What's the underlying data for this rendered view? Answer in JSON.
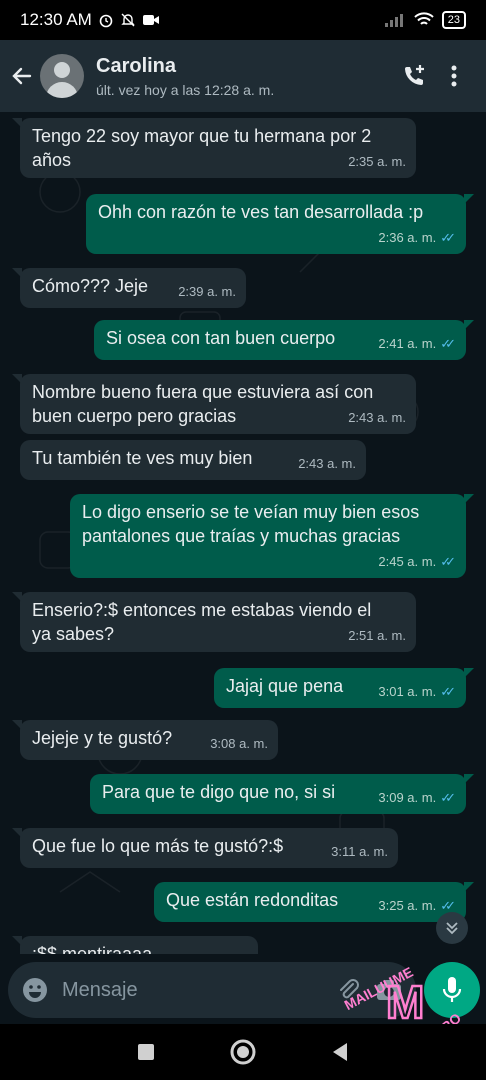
{
  "status_bar": {
    "time": "12:30 AM",
    "battery": "23"
  },
  "header": {
    "contact_name": "Carolina",
    "last_seen": "últ. vez hoy a las 12:28 a. m."
  },
  "messages": [
    {
      "dir": "in",
      "text": "Tengo 22 soy mayor que tu hermana por 2\naños",
      "time": "2:35 a. m."
    },
    {
      "dir": "out",
      "text": "Ohh con razón te ves tan desarrollada :p",
      "time": "2:36 a. m."
    },
    {
      "dir": "in",
      "text": "Cómo??? Jeje",
      "time": "2:39 a. m."
    },
    {
      "dir": "out",
      "text": "Si osea con tan buen cuerpo",
      "time": "2:41 a. m."
    },
    {
      "dir": "in",
      "text": "Nombre bueno fuera que estuviera así con\nbuen cuerpo pero gracias",
      "time": "2:43 a. m."
    },
    {
      "dir": "in",
      "text": "Tu también te ves muy bien",
      "time": "2:43 a. m."
    },
    {
      "dir": "out",
      "text": "Lo digo enserio se te veían muy bien esos\npantalones que traías y muchas gracias",
      "time": "2:45 a. m."
    },
    {
      "dir": "in",
      "text": "Enserio?:$ entonces me estabas viendo el\nya sabes?",
      "time": "2:51 a. m."
    },
    {
      "dir": "out",
      "text": "Jajaj que pena",
      "time": "3:01 a. m."
    },
    {
      "dir": "in",
      "text": "Jejeje y te gustó?",
      "time": "3:08 a. m."
    },
    {
      "dir": "out",
      "text": "Para que te digo que no, si si",
      "time": "3:09 a. m."
    },
    {
      "dir": "in",
      "text": "Que fue lo que más te gustó?:$",
      "time": "3:11 a. m."
    },
    {
      "dir": "out",
      "text": "Que están redonditas",
      "time": "3:25 a. m."
    },
    {
      "dir": "in",
      "text": ":$$ mentiraaaa",
      "time": ""
    }
  ],
  "composer": {
    "placeholder": "Mensaje"
  },
  "watermark": {
    "top_text": "MAILUUME",
    "letter": "M",
    "bottom_text": "PORNO CASERO"
  },
  "colors": {
    "incoming": "#202c33",
    "outgoing": "#005c4b",
    "accent": "#00a884",
    "read_ticks": "#53bdeb",
    "watermark": "#ff7fd0"
  }
}
